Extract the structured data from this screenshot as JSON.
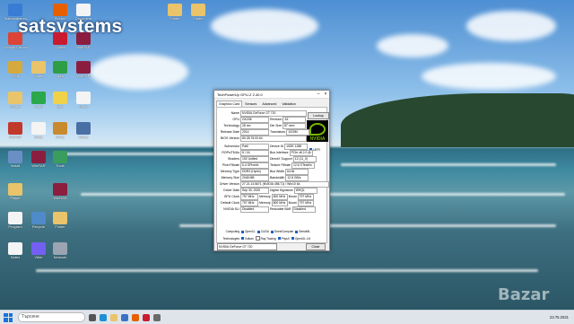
{
  "brand": {
    "text": "satsystems",
    "watermark": "Bazar"
  },
  "desktop_icons": [
    {
      "label": "Този компютър",
      "color": "#3a7bd5"
    },
    {
      "label": "Firefox",
      "color": "#e66000"
    },
    {
      "label": "Document",
      "color": "#f4f4f4"
    },
    {
      "label": "Folder",
      "color": "#e9c46a"
    },
    {
      "label": "Folder",
      "color": "#e9c46a"
    },
    {
      "label": "Google Chrome",
      "color": "#db4437"
    },
    {
      "label": "Opera",
      "color": "#c81b30"
    },
    {
      "label": "WinRAR",
      "color": "#8b1e3f"
    },
    {
      "label": "Tools",
      "color": "#d6a93c"
    },
    {
      "label": "Folder",
      "color": "#e9c46a"
    },
    {
      "label": "Apps",
      "color": "#2e9e44"
    },
    {
      "label": "WinRAR",
      "color": "#8b1e3f"
    },
    {
      "label": "Folder",
      "color": "#e9c46a"
    },
    {
      "label": "Scan",
      "color": "#2aa84a"
    },
    {
      "label": "Disc",
      "color": "#f0d24a"
    },
    {
      "label": "Clock",
      "color": "#f4f4f4"
    },
    {
      "label": "AIDA64",
      "color": "#c0392b"
    },
    {
      "label": "Docs",
      "color": "#f4f4f4"
    },
    {
      "label": "Drive",
      "color": "#c98a2e"
    },
    {
      "label": "Setup",
      "color": "#4a6fa5"
    },
    {
      "label": "Install",
      "color": "#6a8fc5"
    },
    {
      "label": "WinRAR",
      "color": "#8b1e3f"
    },
    {
      "label": "Tools",
      "color": "#3a9d5d"
    },
    {
      "label": "Player",
      "color": "#e9c46a"
    },
    {
      "label": "WinRAR",
      "color": "#8b1e3f"
    },
    {
      "label": "Program",
      "color": "#f4f4f4"
    },
    {
      "label": "Recycle",
      "color": "#4f8ac9"
    },
    {
      "label": "Folder",
      "color": "#e9c46a"
    },
    {
      "label": "Notes",
      "color": "#f4f4f4"
    },
    {
      "label": "Viber",
      "color": "#7360f2"
    },
    {
      "label": "Network",
      "color": "#9aa5b1"
    }
  ],
  "gpuz": {
    "title": "TechPowerUp GPU-Z 2.40.0",
    "tabs": [
      "Graphics Card",
      "Sensors",
      "Advanced",
      "Validation"
    ],
    "lookup": "Lookup",
    "uefi": "UEFI",
    "rows": [
      {
        "k": "Name",
        "v": "NVIDIA GeForce GT 720"
      },
      {
        "k": "GPU",
        "v": "GK208",
        "k2": "Revision",
        "v2": "A1"
      },
      {
        "k": "Technology",
        "v": "28 nm",
        "k2": "Die Size",
        "v2": "87 mm²"
      },
      {
        "k": "Release Date",
        "v": "2014",
        "k2": "Transistors",
        "v2": "1020M"
      },
      {
        "k": "BIOS Version",
        "v": "80.28.78.00.64"
      },
      {
        "k": "Subvendor",
        "v": "Palit",
        "k2": "Device ID",
        "v2": "10DE 1288"
      },
      {
        "k": "ROPs/TMUs",
        "v": "8 / 16",
        "k2": "Bus Interface",
        "v2": "PCIe x8 2.0 @ x8 1.1"
      },
      {
        "k": "Shaders",
        "v": "192 Unified",
        "k2": "DirectX Support",
        "v2": "12 (11_0)"
      },
      {
        "k": "Pixel Fillrate",
        "v": "6.4 GPixel/s",
        "k2": "Texture Fillrate",
        "v2": "12.6 GTexel/s"
      },
      {
        "k": "Memory Type",
        "v": "DDR3 (Hynix)",
        "k2": "Bus Width",
        "v2": "64 bit"
      },
      {
        "k": "Memory Size",
        "v": "2048 MB",
        "k2": "Bandwidth",
        "v2": "12.8 GB/s"
      },
      {
        "k": "Driver Version",
        "v": "27.21.14.5671 (NVIDIA 456.71) / Win10 64"
      },
      {
        "k": "Driver Date",
        "v": "Sep 30, 2020",
        "k2": "Digital Signature",
        "v2": "WHQL"
      },
      {
        "k": "GPU Clock",
        "v": "797 MHz",
        "k2": "Memory",
        "v2": "800 MHz",
        "k3": "Boost",
        "v3": "797 MHz"
      },
      {
        "k": "Default Clock",
        "v": "797 MHz",
        "k2": "Memory",
        "v2": "800 MHz",
        "k3": "Boost",
        "v3": "797 MHz"
      },
      {
        "k": "NVIDIA SLI",
        "v": "Disabled",
        "k2": "Resizable BAR",
        "v2": "Disabled"
      }
    ],
    "computing_label": "Computing",
    "computing": [
      "OpenCL",
      "CUDA",
      "DirectCompute",
      "DirectML"
    ],
    "technologies_label": "Technologies",
    "technologies": [
      "Vulkan",
      "Ray Tracing",
      "PhysX",
      "OpenGL 4.6"
    ],
    "selected_card": "NVIDIA GeForce GT 720",
    "close": "Close",
    "logo_text": "NVIDIA"
  },
  "taskbar": {
    "search_placeholder": "Търсене",
    "time": "",
    "date": "23.75.2021"
  }
}
